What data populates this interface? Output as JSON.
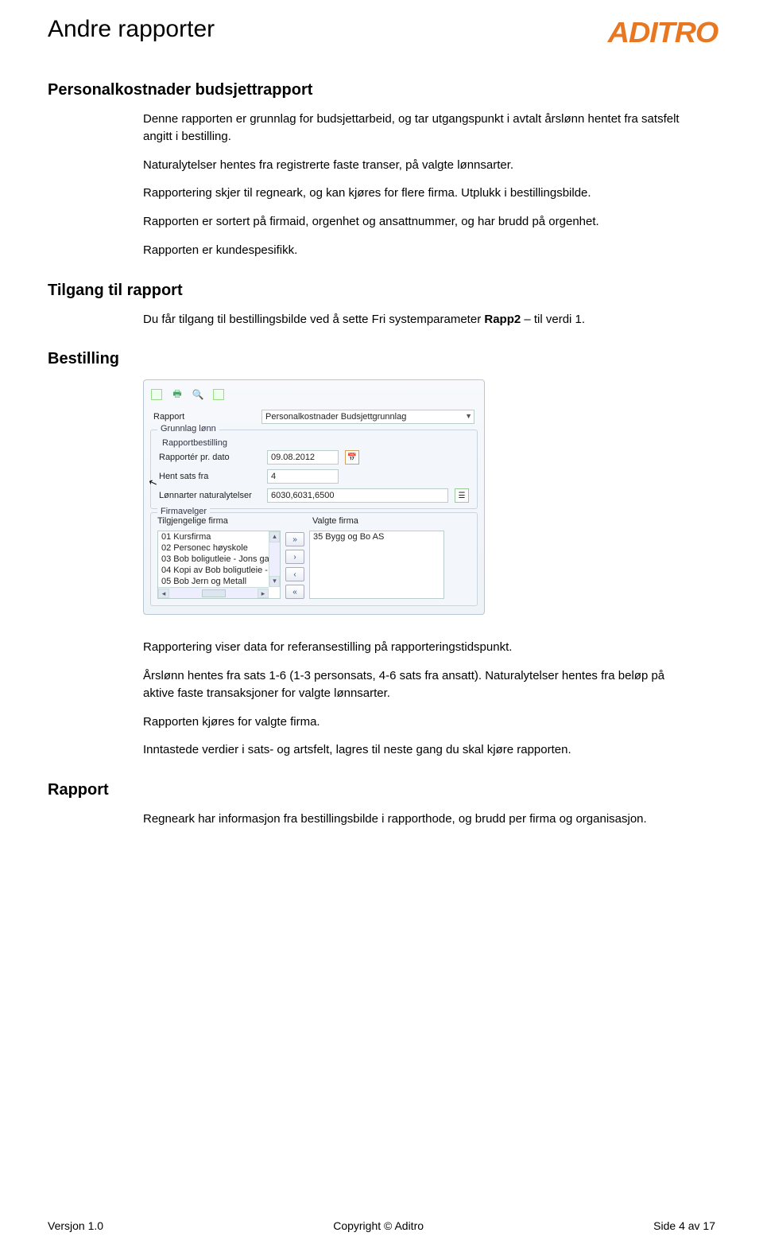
{
  "header": {
    "doc_title": "Andre rapporter",
    "logo_text": "ADITRO"
  },
  "section1": {
    "title": "Personalkostnader budsjettrapport",
    "p1": "Denne rapporten er grunnlag for budsjettarbeid, og tar utgangspunkt i avtalt årslønn hentet fra satsfelt angitt i bestilling.",
    "p2": "Naturalytelser hentes fra registrerte faste transer, på valgte lønnsarter.",
    "p3": "Rapportering skjer til regneark, og kan kjøres for flere firma. Utplukk i bestillingsbilde.",
    "p4": "Rapporten er sortert på firmaid, orgenhet og ansattnummer, og har brudd på orgenhet.",
    "p5": "Rapporten er kundespesifikk."
  },
  "section2": {
    "title": "Tilgang til rapport",
    "p1_pre": "Du får tilgang til bestillingsbilde ved å sette Fri systemparameter ",
    "p1_bold": "Rapp2",
    "p1_post": " – til verdi 1."
  },
  "section3": {
    "title": "Bestilling"
  },
  "screenshot": {
    "rapport_label": "Rapport",
    "rapport_value": "Personalkostnader Budsjettgrunnlag",
    "group1": "Grunnlag lønn",
    "group1_sub": "Rapportbestilling",
    "dato_label": "Rapportér pr. dato",
    "dato_value": "09.08.2012",
    "hent_label": "Hent sats fra",
    "hent_value": "4",
    "lonn_label": "Lønnarter naturalytelser",
    "lonn_value": "6030,6031,6500",
    "firmavelger": "Firmavelger",
    "tilgjengelige": "Tilgjengelige firma",
    "valgte": "Valgte firma",
    "avail": [
      "01 Kursfirma",
      "02 Personec høyskole",
      "03 Bob boligutleie - Jons ga",
      "04 Kopi av Bob boligutleie -",
      "05 Bob Jern og Metall"
    ],
    "selected": [
      "35 Bygg og Bo AS"
    ]
  },
  "section4": {
    "p1": "Rapportering viser data for referansestilling på rapporteringstidspunkt.",
    "p2": "Årslønn hentes fra sats 1-6 (1-3 personsats, 4-6 sats fra ansatt). Naturalytelser hentes fra beløp på aktive faste transaksjoner for valgte lønnsarter.",
    "p3": "Rapporten kjøres for valgte firma.",
    "p4": "Inntastede verdier i sats- og artsfelt, lagres til neste gang du skal kjøre rapporten."
  },
  "section5": {
    "title": "Rapport",
    "p1": "Regneark har informasjon fra bestillingsbilde i rapporthode, og brudd per firma og organisasjon."
  },
  "footer": {
    "left": "Versjon 1.0",
    "center": "Copyright © Aditro",
    "right": "Side 4 av 17"
  }
}
